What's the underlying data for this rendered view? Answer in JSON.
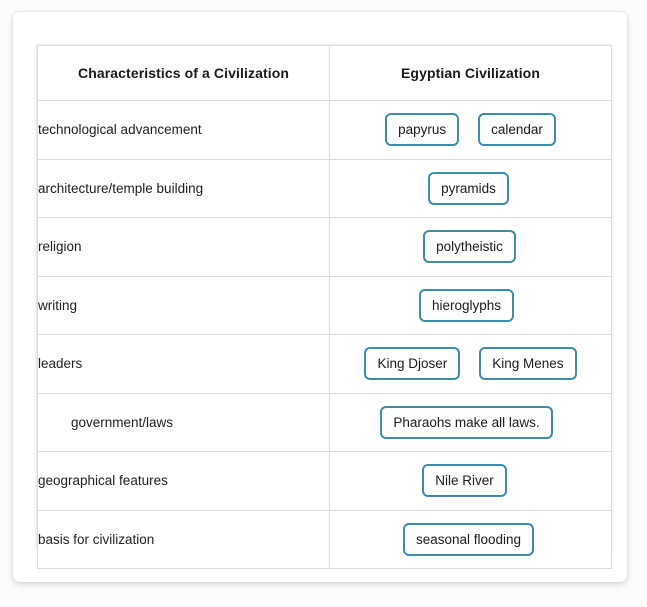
{
  "table": {
    "columns": [
      "Characteristics of a Civilization",
      "Egyptian Civilization"
    ],
    "accent_color": "#3d8ca9",
    "border_color": "#dcdcdc",
    "rows": [
      {
        "characteristic": "technological advancement",
        "answers": [
          "papyrus",
          "calendar"
        ]
      },
      {
        "characteristic": "architecture/temple building",
        "answers": [
          "pyramids"
        ]
      },
      {
        "characteristic": "religion",
        "answers": [
          "polytheistic"
        ]
      },
      {
        "characteristic": "writing",
        "answers": [
          "hieroglyphs"
        ]
      },
      {
        "characteristic": "leaders",
        "answers": [
          "King Djoser",
          "King Menes"
        ]
      },
      {
        "characteristic": "government/laws",
        "answers": [
          "Pharaohs make all laws."
        ]
      },
      {
        "characteristic": "geographical features",
        "answers": [
          "Nile River"
        ]
      },
      {
        "characteristic": "basis for civilization",
        "answers": [
          "seasonal flooding"
        ]
      }
    ]
  }
}
